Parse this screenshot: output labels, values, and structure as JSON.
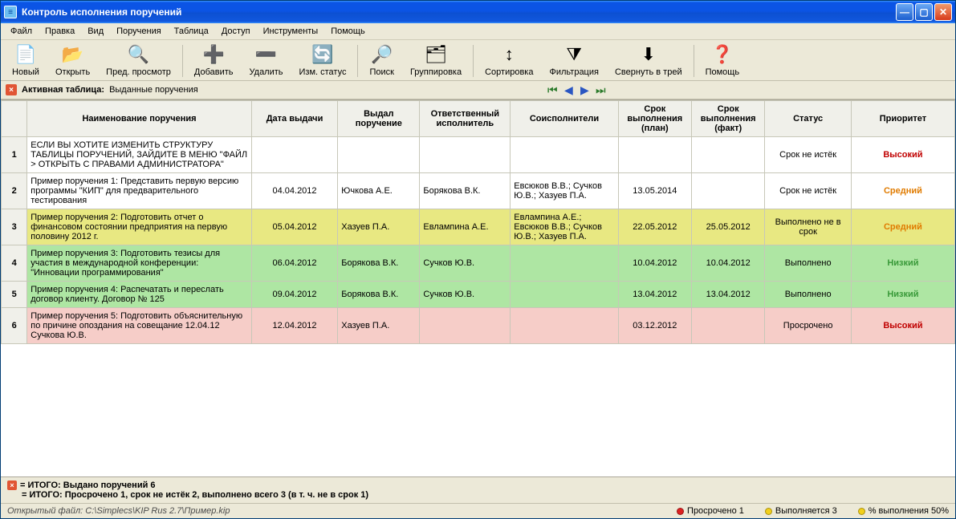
{
  "title": "Контроль исполнения поручений",
  "menu": [
    "Файл",
    "Правка",
    "Вид",
    "Поручения",
    "Таблица",
    "Доступ",
    "Инструменты",
    "Помощь"
  ],
  "toolbar": [
    {
      "label": "Новый",
      "icon": "📄"
    },
    {
      "label": "Открыть",
      "icon": "📂"
    },
    {
      "label": "Пред. просмотр",
      "icon": "🔍"
    },
    {
      "label": "Добавить",
      "icon": "➕"
    },
    {
      "label": "Удалить",
      "icon": "➖"
    },
    {
      "label": "Изм. статус",
      "icon": "🔄"
    },
    {
      "label": "Поиск",
      "icon": "🔎"
    },
    {
      "label": "Группировка",
      "icon": "🗂"
    },
    {
      "label": "Сортировка",
      "icon": "↕"
    },
    {
      "label": "Фильтрация",
      "icon": "⧩"
    },
    {
      "label": "Свернуть в трей",
      "icon": "⬇"
    },
    {
      "label": "Помощь",
      "icon": "❓"
    }
  ],
  "activeStrip": {
    "label": "Активная таблица:",
    "value": "Выданные поручения"
  },
  "columns": [
    "",
    "Наименование поручения",
    "Дата выдачи",
    "Выдал поручение",
    "Ответственный исполнитель",
    "Соисполнители",
    "Срок выполнения (план)",
    "Срок выполнения (факт)",
    "Статус",
    "Приоритет"
  ],
  "rows": [
    {
      "num": "1",
      "rowClass": "",
      "name": "ЕСЛИ ВЫ ХОТИТЕ ИЗМЕНИТЬ СТРУКТУРУ ТАБЛИЦЫ ПОРУЧЕНИЙ, ЗАЙДИТЕ В МЕНЮ \"ФАЙЛ > ОТКРЫТЬ С ПРАВАМИ АДМИНИСТРАТОРА\"",
      "date": "",
      "issuer": "",
      "resp": "",
      "co": "",
      "plan": "",
      "fact": "",
      "status": "Срок не истёк",
      "prio": "Высокий",
      "prioClass": "prio-high"
    },
    {
      "num": "2",
      "rowClass": "",
      "name": "Пример поручения 1: Представить первую версию программы \"КИП\" для предварительного тестирования",
      "date": "04.04.2012",
      "issuer": "Ючкова А.Е.",
      "resp": "Борякова В.К.",
      "co": "Евсюков В.В.; Сучков Ю.В.; Хазуев П.А.",
      "plan": "13.05.2014",
      "fact": "",
      "status": "Срок не истёк",
      "prio": "Средний",
      "prioClass": "prio-med"
    },
    {
      "num": "3",
      "rowClass": "status-yellow",
      "name": "Пример поручения 2: Подготовить отчет о финансовом состоянии предприятия на первую половину 2012 г.",
      "date": "05.04.2012",
      "issuer": "Хазуев П.А.",
      "resp": "Евлампина А.Е.",
      "co": "Евлампина А.Е.; Евсюков В.В.; Сучков Ю.В.; Хазуев П.А.",
      "plan": "22.05.2012",
      "fact": "25.05.2012",
      "status": "Выполнено не в срок",
      "prio": "Средний",
      "prioClass": "prio-med"
    },
    {
      "num": "4",
      "rowClass": "status-green",
      "name": "Пример поручения 3: Подготовить тезисы для участия в международной конференции: \"Инновации программирования\"",
      "date": "06.04.2012",
      "issuer": "Борякова В.К.",
      "resp": "Сучков Ю.В.",
      "co": "",
      "plan": "10.04.2012",
      "fact": "10.04.2012",
      "status": "Выполнено",
      "prio": "Низкий",
      "prioClass": "prio-low"
    },
    {
      "num": "5",
      "rowClass": "status-green",
      "name": "Пример поручения 4: Распечатать и переслать договор клиенту. Договор № 125",
      "date": "09.04.2012",
      "issuer": "Борякова В.К.",
      "resp": "Сучков Ю.В.",
      "co": "",
      "plan": "13.04.2012",
      "fact": "13.04.2012",
      "status": "Выполнено",
      "prio": "Низкий",
      "prioClass": "prio-low"
    },
    {
      "num": "6",
      "rowClass": "status-pink",
      "name": "Пример поручения 5: Подготовить объяснительную по причине опоздания на совещание 12.04.12 Сучкова Ю.В.",
      "date": "12.04.2012",
      "issuer": "Хазуев П.А.",
      "resp": "",
      "co": "",
      "plan": "03.12.2012",
      "fact": "",
      "status": "Просрочено",
      "prio": "Высокий",
      "prioClass": "prio-high"
    }
  ],
  "summary": {
    "line1": "= ИТОГО: Выдано поручений 6",
    "line2": "= ИТОГО: Просрочено 1, срок не истёк 2, выполнено всего 3 (в т. ч. не в срок 1)"
  },
  "statusbar": {
    "path": "Открытый файл: C:\\Simplecs\\KIP Rus 2.7\\Пример.kip",
    "expired": "Просрочено 1",
    "running": "Выполняется 3",
    "percent": "% выполнения 50%"
  }
}
